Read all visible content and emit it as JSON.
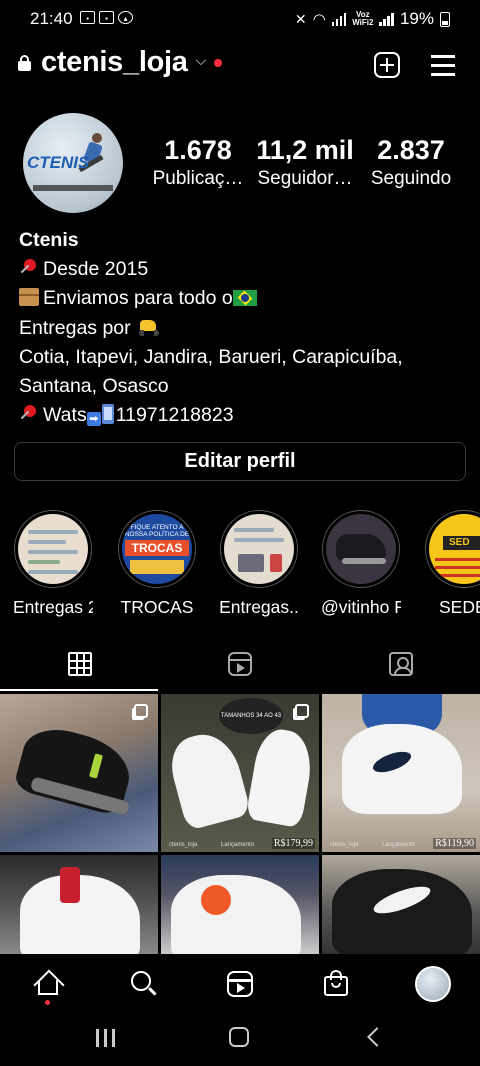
{
  "status_bar": {
    "time": "21:40",
    "voz_line1": "Voz",
    "voz_line2": "WiFi2",
    "battery": "19%"
  },
  "header": {
    "username": "ctenis_loja",
    "icons": [
      "lock-icon",
      "chevron-down-icon",
      "new-post-icon",
      "menu-icon"
    ],
    "notification_dot_color": "#ff3040"
  },
  "profile": {
    "avatar_text": "CTENIS",
    "stats": [
      {
        "value": "1.678",
        "label": "Publicaç…"
      },
      {
        "value": "11,2 mil",
        "label": "Seguidor…"
      },
      {
        "value": "2.837",
        "label": "Seguindo"
      }
    ],
    "bio": {
      "name": "Ctenis",
      "line1": "Desde 2015",
      "line2": "Enviamos para todo o",
      "line3": "Entregas por ",
      "line4": "Cotia, Itapevi, Jandira, Barueri, Carapicuíba,",
      "line5": "Santana, Osasco",
      "line6_prefix": "Wats",
      "line6_number": "11971218823"
    },
    "edit_button": "Editar perfil"
  },
  "highlights": [
    {
      "label": "Entregas 2"
    },
    {
      "label": "TROCAS",
      "cover_text_top": "FIQUE ATENTO A NOSSA POLÍTICA DE",
      "cover_text_main": "TROCAS"
    },
    {
      "label": "Entregas.."
    },
    {
      "label": "@vitinho F…"
    },
    {
      "label": "SEDE",
      "cover_text_main": "SED"
    }
  ],
  "tabs": [
    "grid-icon",
    "reels-icon",
    "tagged-icon"
  ],
  "posts": [
    {
      "multi": true
    },
    {
      "multi": true,
      "badge": "TAMANHOS 34 AO 43",
      "handle": "ctenis_loja",
      "tag": "Lançamento",
      "price": "R$179,99"
    },
    {
      "handle": "ctenis_loja",
      "tag": "Lançamento",
      "price": "R$119,90"
    },
    {},
    {},
    {}
  ],
  "bottom_nav": [
    "home-icon",
    "search-icon",
    "reels-icon",
    "shop-icon",
    "profile-icon"
  ],
  "android_nav": [
    "recent-apps-icon",
    "home-button-icon",
    "back-icon"
  ]
}
